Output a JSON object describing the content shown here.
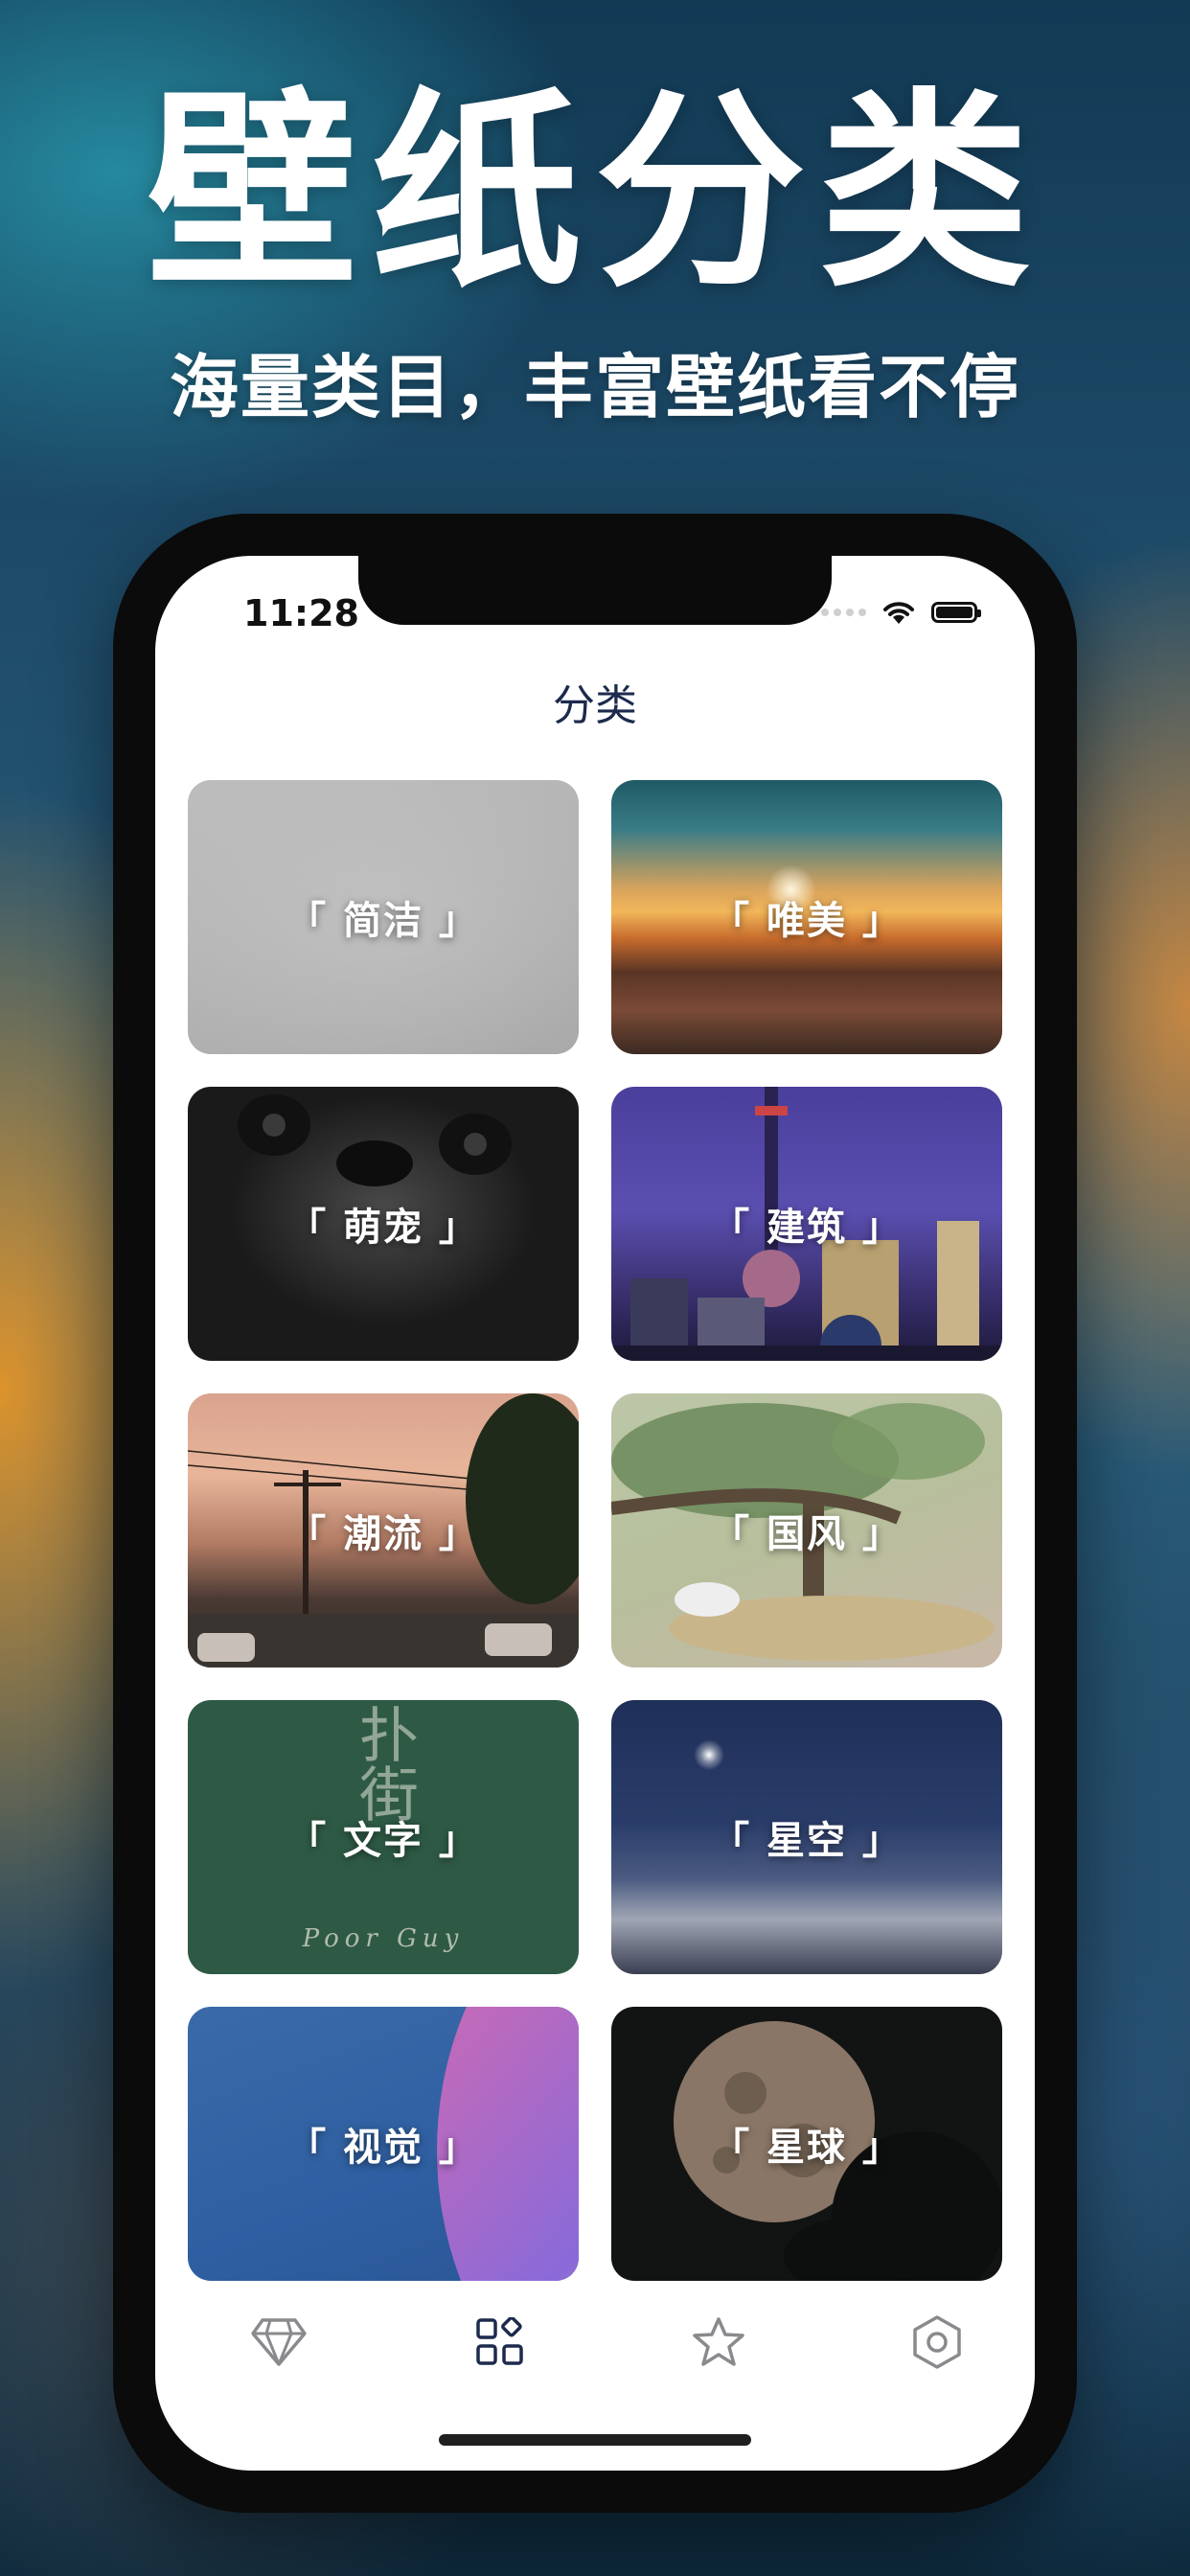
{
  "hero": {
    "title": "壁纸分类",
    "subtitle": "海量类目，丰富壁纸看不停"
  },
  "status_bar": {
    "time": "11:28"
  },
  "nav": {
    "title": "分类"
  },
  "categories": [
    {
      "label": "「 简洁 」"
    },
    {
      "label": "「 唯美 」"
    },
    {
      "label": "「 萌宠 」"
    },
    {
      "label": "「 建筑 」"
    },
    {
      "label": "「 潮流 」"
    },
    {
      "label": "「 国风 」"
    },
    {
      "label": "「 文字 」",
      "art_text": "扑街",
      "art_caption": "Poor Guy"
    },
    {
      "label": "「 星空 」"
    },
    {
      "label": "「 视觉 」"
    },
    {
      "label": "「 星球 」"
    }
  ],
  "tab_bar": {
    "items": [
      {
        "icon": "diamond-icon",
        "active": false
      },
      {
        "icon": "grid-icon",
        "active": true
      },
      {
        "icon": "star-icon",
        "active": false
      },
      {
        "icon": "hexagon-settings-icon",
        "active": false
      }
    ],
    "active_color": "#1d2a4d",
    "inactive_color": "#8a8a8e"
  }
}
